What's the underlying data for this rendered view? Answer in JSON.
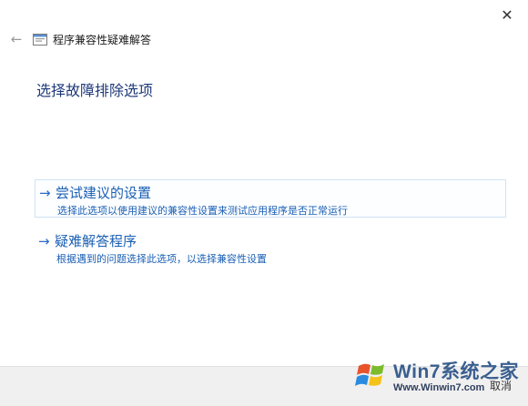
{
  "window": {
    "title": "程序兼容性疑难解答",
    "close_icon": "close-icon",
    "back_icon": "back-arrow-icon"
  },
  "page": {
    "heading": "选择故障排除选项"
  },
  "options": [
    {
      "label": "尝试建议的设置",
      "description": "选择此选项以使用建议的兼容性设置来测试应用程序是否正常运行"
    },
    {
      "label": "疑难解答程序",
      "description": "根据遇到的问题选择此选项，以选择兼容性设置"
    }
  ],
  "footer": {
    "cancel_label": "取消"
  },
  "watermark": {
    "main_text": "Win7系统之家",
    "url_text": "Www.Winwin7.com"
  },
  "colors": {
    "accent": "#1a5fb4",
    "heading": "#1f3a7a",
    "footer_bg": "#f0f0f0"
  }
}
